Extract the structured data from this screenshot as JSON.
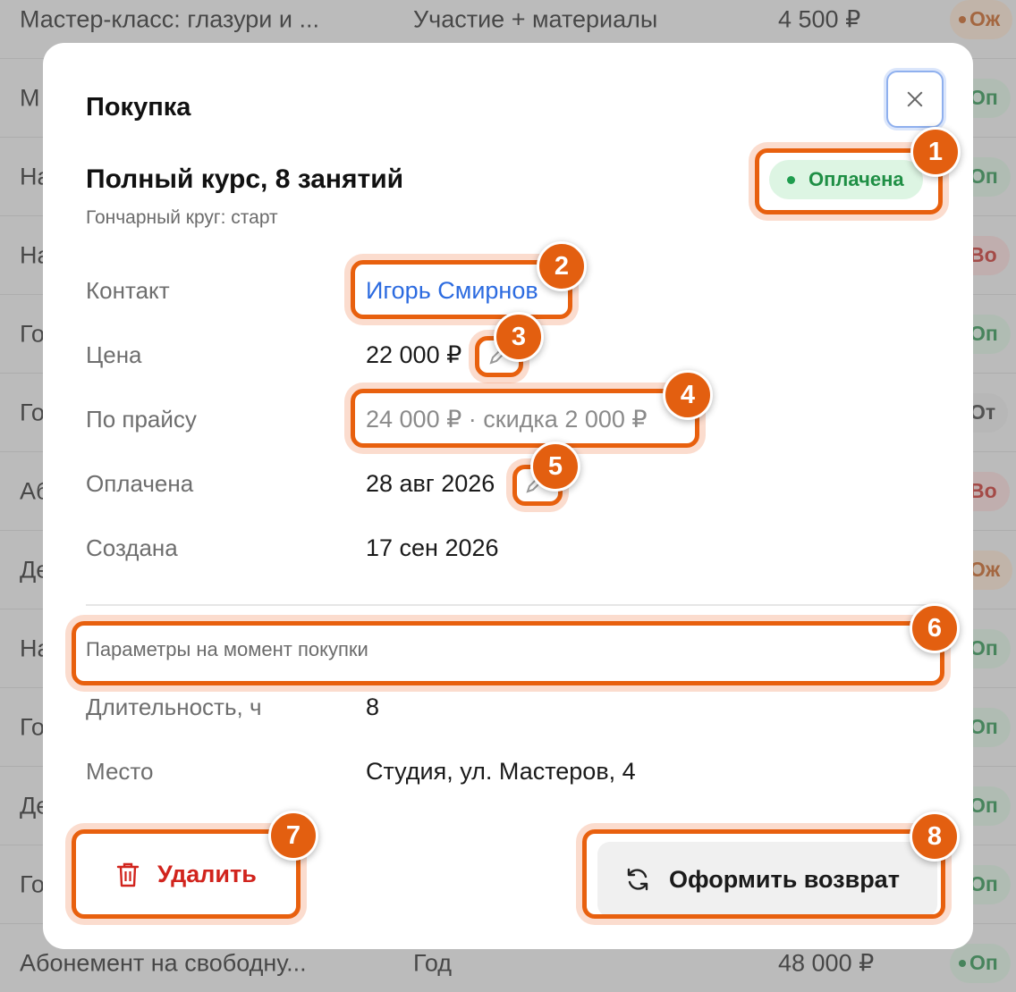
{
  "background_rows": [
    {
      "name": "Мастер-класс: глазури и ...",
      "type": "Участие + материалы",
      "price": "4 500 ₽",
      "status": "Ож",
      "status_color": "orange"
    },
    {
      "name": "М",
      "type": "",
      "price": "",
      "status": "Оп",
      "status_color": "green"
    },
    {
      "name": "На",
      "type": "",
      "price": "",
      "status": "Оп",
      "status_color": "green"
    },
    {
      "name": "На",
      "type": "",
      "price": "",
      "status": "Во",
      "status_color": "red"
    },
    {
      "name": "Го",
      "type": "",
      "price": "",
      "status": "Оп",
      "status_color": "green"
    },
    {
      "name": "Го",
      "type": "",
      "price": "",
      "status": "От",
      "status_color": "gray"
    },
    {
      "name": "Аб",
      "type": "",
      "price": "",
      "status": "Во",
      "status_color": "red"
    },
    {
      "name": "Де",
      "type": "",
      "price": "",
      "status": "Ож",
      "status_color": "orange"
    },
    {
      "name": "На",
      "type": "",
      "price": "",
      "status": "Оп",
      "status_color": "green"
    },
    {
      "name": "Го",
      "type": "",
      "price": "",
      "status": "Оп",
      "status_color": "green"
    },
    {
      "name": "Де",
      "type": "",
      "price": "",
      "status": "Оп",
      "status_color": "green"
    },
    {
      "name": "Го",
      "type": "",
      "price": "",
      "status": "Оп",
      "status_color": "green"
    },
    {
      "name": "Абонемент на свободну...",
      "type": "Год",
      "price": "48 000 ₽",
      "status": "Оп",
      "status_color": "green"
    }
  ],
  "modal": {
    "title": "Покупка",
    "product_name": "Полный курс, 8 занятий",
    "product_subtitle": "Гончарный круг: старт",
    "status": "Оплачена",
    "fields": {
      "contact_label": "Контакт",
      "contact_value": "Игорь Смирнов",
      "price_label": "Цена",
      "price_value": "22 000 ₽",
      "list_price_label": "По прайсу",
      "list_price_value": "24 000 ₽ · скидка 2 000 ₽",
      "paid_label": "Оплачена",
      "paid_value": "28 авг 2026",
      "created_label": "Создана",
      "created_value": "17 сен 2026"
    },
    "section_caption": "Параметры на момент покупки",
    "params": {
      "duration_label": "Длительность, ч",
      "duration_value": "8",
      "place_label": "Место",
      "place_value": "Студия, ул. Мастеров, 4"
    },
    "delete_label": "Удалить",
    "refund_label": "Оформить возврат"
  },
  "markers": [
    "1",
    "2",
    "3",
    "4",
    "5",
    "6",
    "7",
    "8"
  ],
  "colors": {
    "accent": "#e35f10",
    "link": "#2c6be0",
    "status_green": "#1f8f45",
    "danger": "#d1241d"
  }
}
